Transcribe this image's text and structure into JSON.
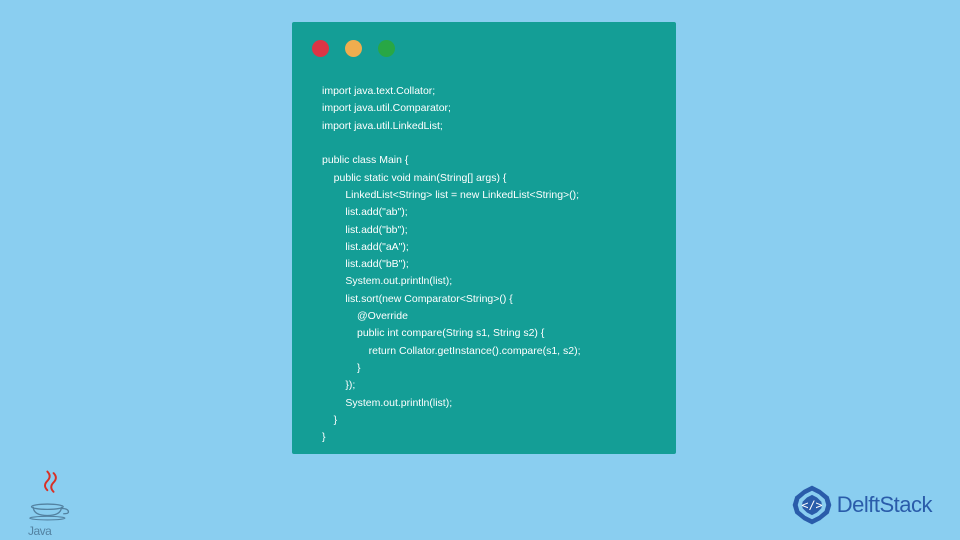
{
  "code": {
    "lines": [
      "import java.text.Collator;",
      "import java.util.Comparator;",
      "import java.util.LinkedList;",
      "",
      "public class Main {",
      "    public static void main(String[] args) {",
      "        LinkedList<String> list = new LinkedList<String>();",
      "        list.add(\"ab\");",
      "        list.add(\"bb\");",
      "        list.add(\"aA\");",
      "        list.add(\"bB\");",
      "        System.out.println(list);",
      "        list.sort(new Comparator<String>() {",
      "            @Override",
      "            public int compare(String s1, String s2) {",
      "                return Collator.getInstance().compare(s1, s2);",
      "            }",
      "        });",
      "        System.out.println(list);",
      "    }",
      "}"
    ]
  },
  "logos": {
    "java_text": "Java",
    "delftstack_text": "DelftStack"
  }
}
